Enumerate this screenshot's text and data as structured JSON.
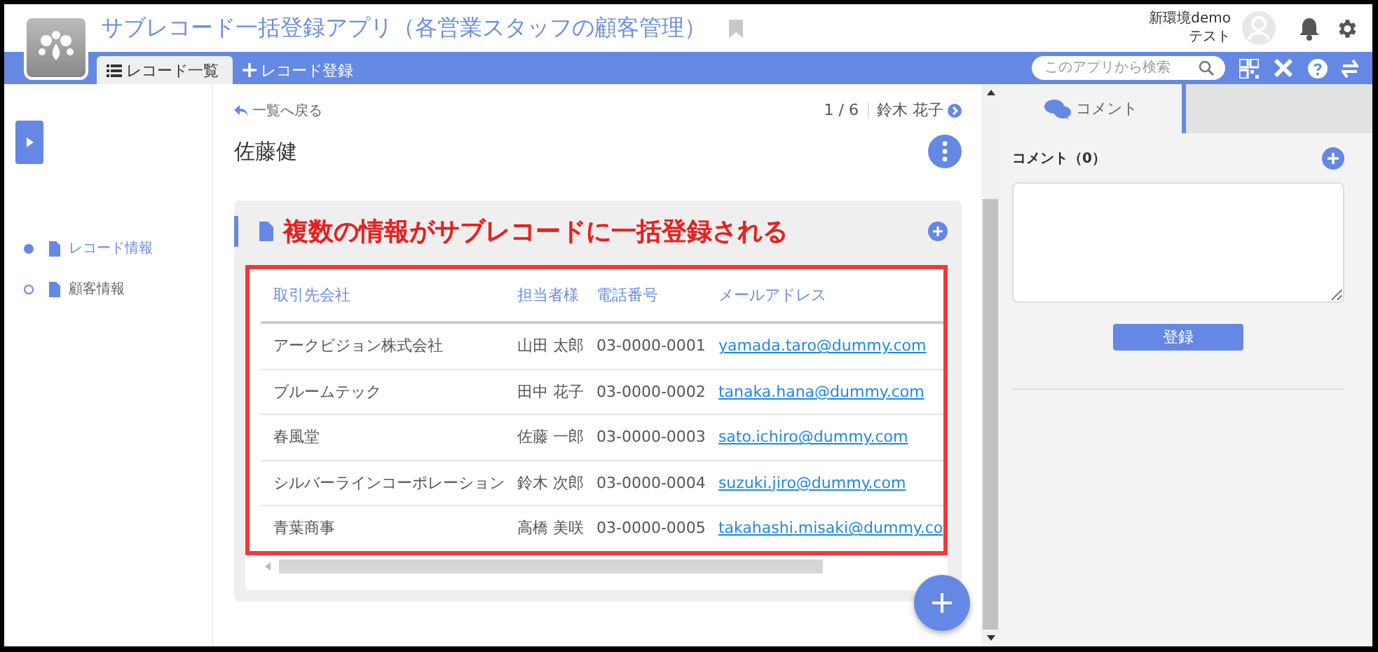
{
  "app": {
    "title": "サブレコード一括登録アプリ（各営業スタッフの顧客管理）"
  },
  "user": {
    "environment": "新環境demo",
    "name": "テスト"
  },
  "tabs": [
    {
      "label": "レコード一覧",
      "selected": true
    },
    {
      "label": "レコード登録",
      "selected": false
    }
  ],
  "search": {
    "placeholder": "このアプリから検索"
  },
  "record": {
    "back": "一覧へ戻る",
    "position": "1 / 6",
    "next": "鈴木 花子",
    "name": "佐藤健"
  },
  "nav_items": [
    {
      "label": "レコード情報",
      "selected": true
    },
    {
      "label": "顧客情報",
      "selected": false
    }
  ],
  "annotation": "複数の情報がサブレコードに一括登録される",
  "table": {
    "columns": [
      "取引先会社",
      "担当者様",
      "電話番号",
      "メールアドレス"
    ],
    "rows": [
      [
        "アークビジョン株式会社",
        "山田 太郎",
        "03-0000-0001",
        "yamada.taro@dummy.com"
      ],
      [
        "ブルームテック",
        "田中 花子",
        "03-0000-0002",
        "tanaka.hana@dummy.com"
      ],
      [
        "春風堂",
        "佐藤 一郎",
        "03-0000-0003",
        "sato.ichiro@dummy.com"
      ],
      [
        "シルバーラインコーポレーション",
        "鈴木 次郎",
        "03-0000-0004",
        "suzuki.jiro@dummy.com"
      ],
      [
        "青葉商事",
        "高橋 美咲",
        "03-0000-0005",
        "takahashi.misaki@dummy.co"
      ]
    ]
  },
  "comments": {
    "tab": "コメント",
    "heading": "コメント（0）",
    "submit": "登録"
  }
}
